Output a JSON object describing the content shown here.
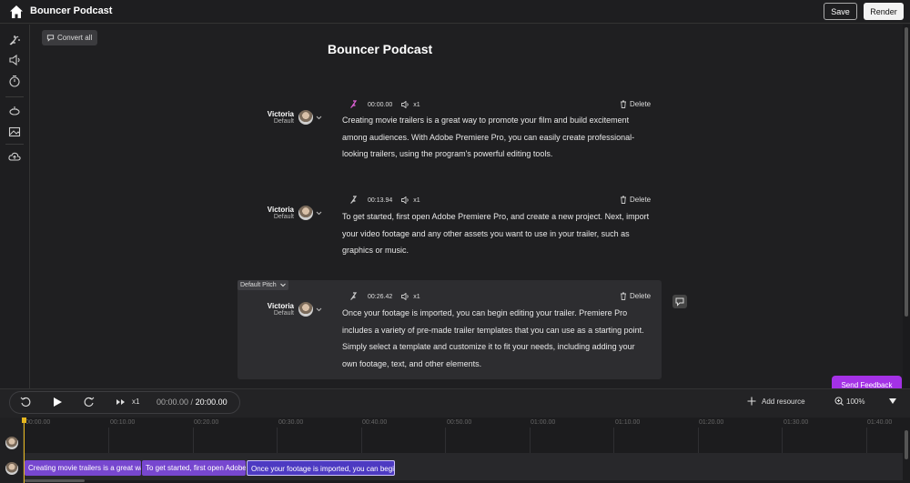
{
  "app": {
    "title": "Bouncer Podcast",
    "icon": "home-icon"
  },
  "header": {
    "save_label": "Save",
    "render_label": "Render"
  },
  "sidebar": {
    "items": [
      {
        "icon": "voice-magic-icon"
      },
      {
        "icon": "speaker-icon"
      },
      {
        "icon": "timer-icon"
      },
      {
        "icon": "mixer-icon"
      },
      {
        "icon": "image-icon"
      },
      {
        "icon": "cloud-upload-icon"
      }
    ]
  },
  "editor": {
    "convert_all_label": "Convert all",
    "doc_title": "Bouncer Podcast",
    "default_pitch_label": "Default Pitch",
    "blocks": [
      {
        "speaker": "Victoria",
        "style": "Default",
        "time": "00:00.00",
        "rate": "x1",
        "delete_label": "Delete",
        "text": "Creating movie trailers is a great way to promote your film and build excitement among audiences. With Adobe Premiere Pro, you can easily create professional-looking trailers, using the program's powerful editing tools."
      },
      {
        "speaker": "Victoria",
        "style": "Default",
        "time": "00:13.94",
        "rate": "x1",
        "delete_label": "Delete",
        "text": "To get started, first open Adobe Premiere Pro, and create a new project. Next, import your video footage and any other assets you want to use in your trailer, such as graphics or music."
      },
      {
        "speaker": "Victoria",
        "style": "Default",
        "time": "00:26.42",
        "rate": "x1",
        "delete_label": "Delete",
        "text": "Once your footage is imported, you can begin editing your trailer. Premiere Pro includes a variety of pre-made trailer templates that you can use as a starting point. Simply select a template and customize it to fit your needs, including adding your own footage, text, and other elements."
      }
    ],
    "send_feedback_label": "Send Feedback"
  },
  "player": {
    "rate": "x1",
    "current_time": "00:00.00",
    "separator": " / ",
    "total_time": "20:00.00",
    "add_resource_label": "Add resource",
    "zoom_label": "100%"
  },
  "timeline": {
    "ticks": [
      "00:00.00",
      "00:10.00",
      "00:20.00",
      "00:30.00",
      "00:40.00",
      "00:50.00",
      "01:00.00",
      "01:10.00",
      "01:20.00",
      "01:30.00",
      "01:40.00"
    ],
    "clips": [
      "Creating movie trailers is a great way to promote your film",
      "To get started, first open Adobe Premiere Pro",
      "Once your footage is imported, you can begin editing"
    ]
  },
  "colors": {
    "accent": "#a431e6",
    "clip": "#7747cf",
    "clip_selected": "#4d3ac2",
    "playhead": "#e6b71f"
  }
}
